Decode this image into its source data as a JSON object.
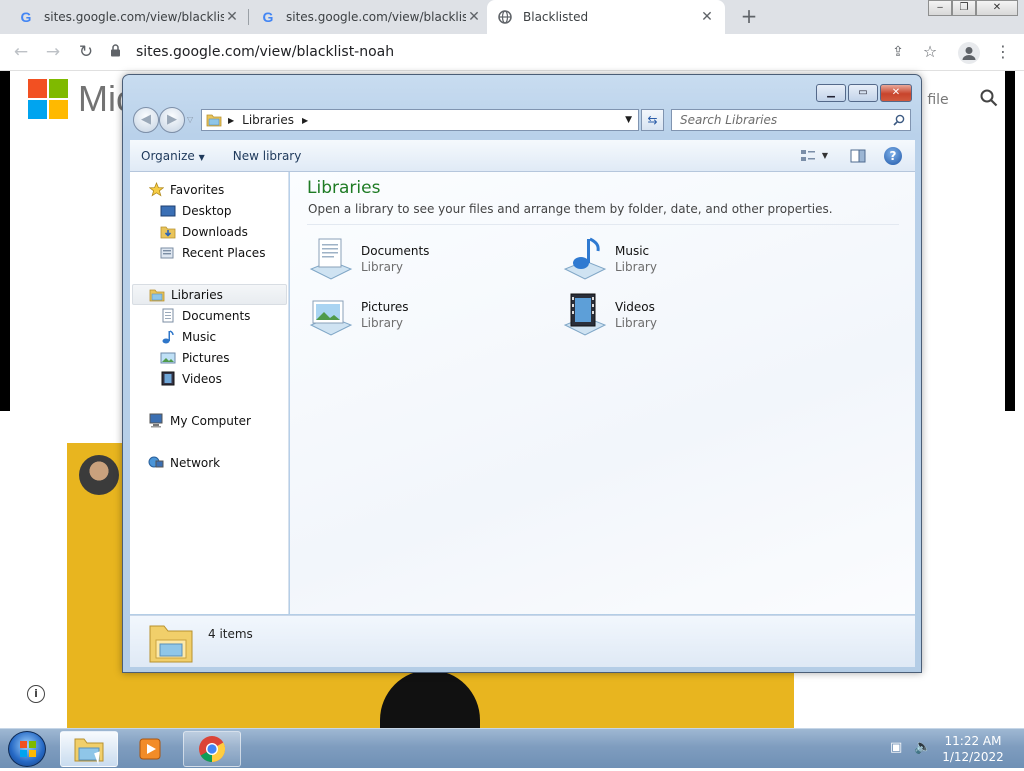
{
  "browser": {
    "tabs": [
      {
        "title": "sites.google.com/view/blacklist-",
        "favicon": "G"
      },
      {
        "title": "sites.google.com/view/blacklist-",
        "favicon": "G"
      },
      {
        "title": "Blacklisted",
        "favicon": "globe"
      }
    ],
    "new_tab": "+",
    "url": "sites.google.com/view/blacklist-noah"
  },
  "page": {
    "brand_text": "Mic",
    "file_text": "d file"
  },
  "explorer": {
    "address": "Libraries",
    "search_placeholder": "Search Libraries",
    "commands": {
      "organize": "Organize",
      "new_library": "New library"
    },
    "nav": {
      "favorites": "Favorites",
      "favorites_items": [
        "Desktop",
        "Downloads",
        "Recent Places"
      ],
      "libraries": "Libraries",
      "libraries_items": [
        "Documents",
        "Music",
        "Pictures",
        "Videos"
      ],
      "computer": "My Computer",
      "network": "Network"
    },
    "content": {
      "title": "Libraries",
      "description": "Open a library to see your files and arrange them by folder, date, and other properties.",
      "items": [
        {
          "name": "Documents",
          "type": "Library"
        },
        {
          "name": "Music",
          "type": "Library"
        },
        {
          "name": "Pictures",
          "type": "Library"
        },
        {
          "name": "Videos",
          "type": "Library"
        }
      ]
    },
    "status": "4 items"
  },
  "taskbar": {
    "time": "11:22 AM",
    "date": "1/12/2022"
  }
}
